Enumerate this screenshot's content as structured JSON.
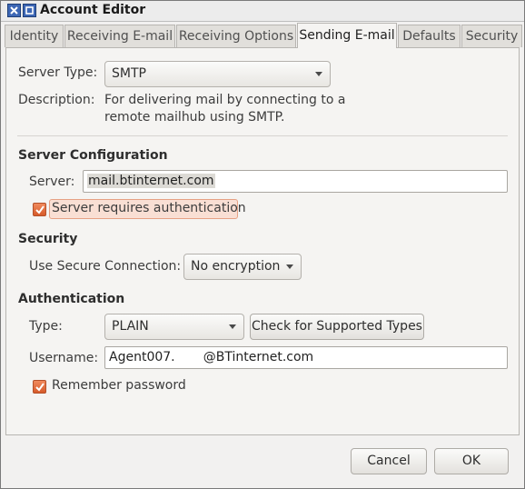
{
  "window": {
    "title": "Account Editor"
  },
  "tabs": [
    {
      "label": "Identity"
    },
    {
      "label": "Receiving E-mail"
    },
    {
      "label": "Receiving Options"
    },
    {
      "label": "Sending E-mail",
      "active": true
    },
    {
      "label": "Defaults"
    },
    {
      "label": "Security"
    }
  ],
  "server_type": {
    "label": "Server Type:",
    "value": "SMTP"
  },
  "description": {
    "label": "Description:",
    "line1": "For delivering mail by connecting to a",
    "line2": "remote mailhub using SMTP."
  },
  "server_config": {
    "heading": "Server Configuration",
    "server_label": "Server:",
    "server_value": "mail.btinternet.com",
    "auth_check_label": "Server requires authentication",
    "auth_checked": true
  },
  "security": {
    "heading": "Security",
    "secure_label": "Use Secure Connection:",
    "secure_value": "No encryption"
  },
  "authentication": {
    "heading": "Authentication",
    "type_label": "Type:",
    "type_value": "PLAIN",
    "check_types_button": "Check for Supported Types",
    "username_label": "Username:",
    "username_value": "Agent007.       @BTinternet.com",
    "remember_label": "Remember password",
    "remember_checked": true
  },
  "footer": {
    "cancel": "Cancel",
    "ok": "OK"
  },
  "colors": {
    "accent": "#e0683a",
    "titlebar_button": "#3d67b5"
  }
}
